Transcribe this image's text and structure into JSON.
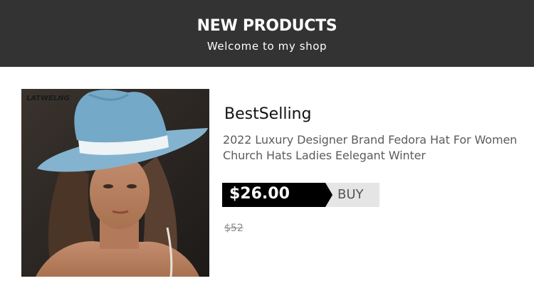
{
  "header": {
    "title": "NEW PRODUCTS",
    "subtitle": "Welcome to my shop"
  },
  "product": {
    "image_alt": "woman wearing light blue wide-brim fedora hat",
    "watermark": "LATWELNG",
    "label": "BestSelling",
    "description": "2022 Luxury Designer Brand Fedora Hat For Women Church Hats Ladies Eelegant Winter",
    "price": "$26.00",
    "buy_label": "BUY",
    "original_price": "$52"
  },
  "colors": {
    "header_bg": "#333333",
    "price_bg": "#000000",
    "buy_bg": "#e5e5e5",
    "hat": "#7fb0cc"
  }
}
